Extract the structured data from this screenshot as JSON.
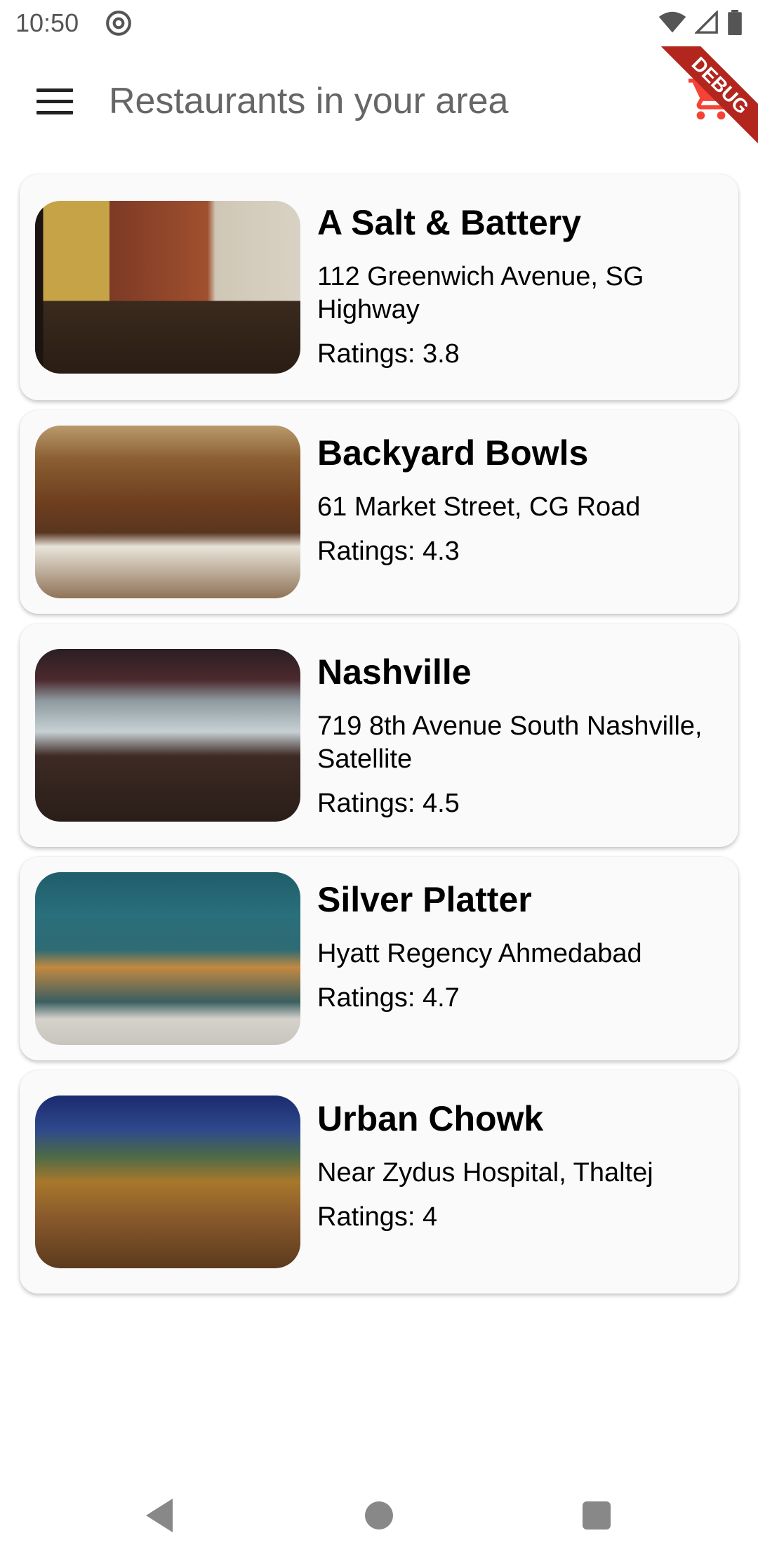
{
  "status_bar": {
    "time": "10:50"
  },
  "app_bar": {
    "title": "Restaurants in your area",
    "debug_label": "DEBUG"
  },
  "colors": {
    "cart": "#f44336",
    "text": "#000000"
  },
  "restaurants": [
    {
      "name": "A Salt & Battery",
      "address": "112 Greenwich Avenue, SG Highway",
      "rating": "Ratings: 3.8",
      "image": "restaurant-interior-bar-photo"
    },
    {
      "name": " Backyard Bowls",
      "address": "61 Market Street, CG Road",
      "rating": "Ratings: 4.3",
      "image": "restaurant-dining-hall-photo"
    },
    {
      "name": "Nashville",
      "address": "719 8th Avenue South Nashville, Satellite",
      "rating": "Ratings: 4.5",
      "image": "sports-bar-interior-photo"
    },
    {
      "name": " Silver Platter",
      "address": "Hyatt Regency Ahmedabad",
      "rating": "Ratings: 4.7",
      "image": "cafe-storefront-photo"
    },
    {
      "name": "Urban Chowk",
      "address": "Near Zydus Hospital, Thaltej",
      "rating": "Ratings: 4",
      "image": "outdoor-courtyard-photo"
    }
  ],
  "icons": {
    "menu": "menu-icon",
    "cart": "shopping-cart-icon",
    "nav_back": "back-icon",
    "nav_home": "home-icon",
    "nav_recent": "recents-icon"
  }
}
